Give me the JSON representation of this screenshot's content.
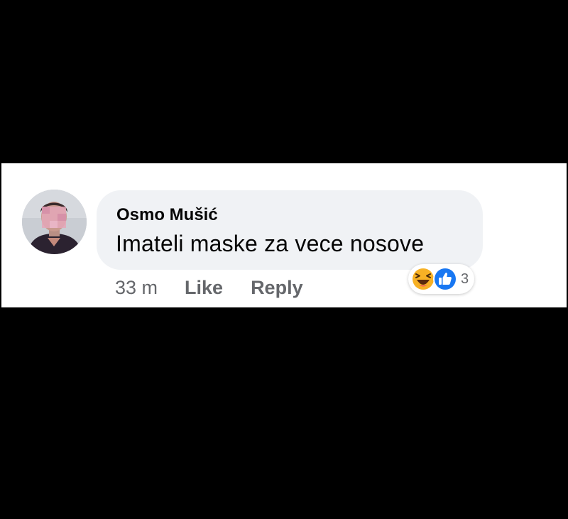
{
  "comment": {
    "author": "Osmo Mušić",
    "text": "Imateli maske za vece nosove",
    "timestamp": "33 m",
    "like_label": "Like",
    "reply_label": "Reply",
    "avatar": "avatar-icon"
  },
  "reactions": {
    "icons": [
      "haha-icon",
      "like-icon"
    ],
    "count": "3"
  },
  "colors": {
    "background": "#000000",
    "panel": "#ffffff",
    "bubble": "#f0f2f5",
    "text": "#050505",
    "meta_text": "#65676b",
    "like_blue": "#1877f2",
    "haha_yellow": "#f7b125"
  }
}
